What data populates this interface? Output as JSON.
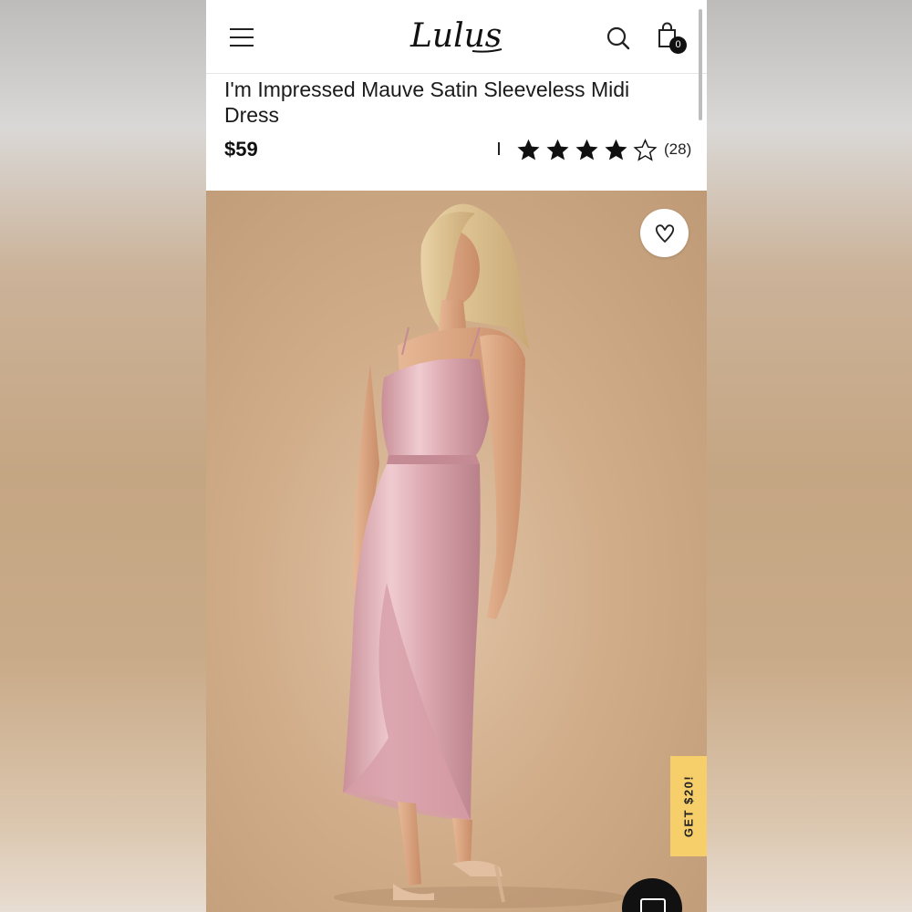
{
  "header": {
    "menu_icon": "hamburger-menu-icon",
    "logo_text": "Lulus",
    "search_icon": "search-icon",
    "bag_icon": "shopping-bag-icon",
    "bag_count": "0"
  },
  "product": {
    "title": "I'm Impressed Mauve Satin Sleeveless Midi Dress",
    "price": "$59",
    "rating": 4,
    "rating_max": 5,
    "review_count": "(28)"
  },
  "hero": {
    "wishlist_icon": "heart-icon",
    "promo_label": "GET $20!",
    "chat_icon": "chat-icon"
  },
  "colors": {
    "accent_promo": "#f6cf6b",
    "text": "#1a1a1a",
    "dress": "#d9a9b0",
    "background": "#cfae8c"
  }
}
